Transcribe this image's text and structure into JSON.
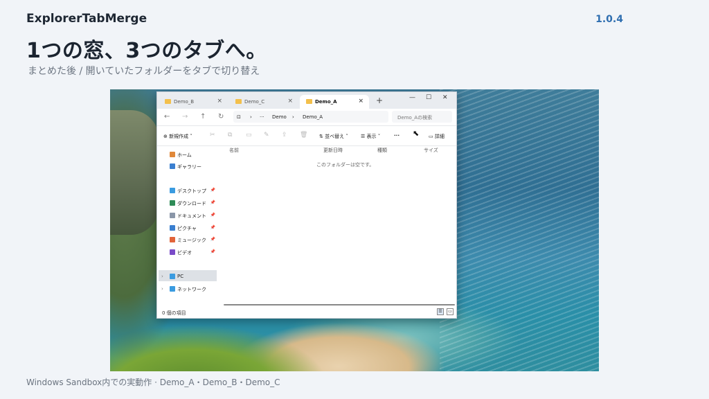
{
  "header": {
    "app_name": "ExplorerTabMerge",
    "version": "1.0.4",
    "headline": "1つの窓、3つのタブへ。",
    "subhead": "まとめた後 / 開いていたフォルダーをタブで切り替え"
  },
  "footer": {
    "caption": "Windows Sandbox内での実動作 · Demo_A・Demo_B・Demo_C"
  },
  "explorer": {
    "tabs": [
      {
        "label": "Demo_B",
        "close": "×"
      },
      {
        "label": "Demo_C",
        "close": "×"
      },
      {
        "label": "Demo_A",
        "close": "×"
      }
    ],
    "new_tab": "+",
    "window_controls": [
      "—",
      "☐",
      "✕"
    ],
    "nav": [
      "←",
      "→",
      "↑",
      "↻"
    ],
    "breadcrumb": [
      "⊡",
      "›",
      "···",
      "Demo",
      "›",
      "Demo_A"
    ],
    "search_placeholder": "Demo_Aの検索",
    "command_bar": {
      "new": "新規作成",
      "sort": "並べ替え",
      "view": "表示",
      "more": "···",
      "details": "詳細"
    },
    "sidebar": [
      {
        "label": "ホーム",
        "icon": "home-icon",
        "color": "#e0883a"
      },
      {
        "label": "ギャラリー",
        "icon": "gallery-icon",
        "color": "#3a7fd0"
      },
      {
        "label": "デスクトップ",
        "icon": "desktop-icon",
        "color": "#3a9be0",
        "pin": "📌"
      },
      {
        "label": "ダウンロード",
        "icon": "download-icon",
        "color": "#2e8b57",
        "pin": "📌"
      },
      {
        "label": "ドキュメント",
        "icon": "document-icon",
        "color": "#8a96a8",
        "pin": "📌"
      },
      {
        "label": "ピクチャ",
        "icon": "pictures-icon",
        "color": "#3a7fd0",
        "pin": "📌"
      },
      {
        "label": "ミュージック",
        "icon": "music-icon",
        "color": "#e2643a",
        "pin": "📌"
      },
      {
        "label": "ビデオ",
        "icon": "video-icon",
        "color": "#7a4bc8",
        "pin": "📌"
      },
      {
        "label": "PC",
        "icon": "pc-icon",
        "color": "#3a9be0"
      },
      {
        "label": "ネットワーク",
        "icon": "network-icon",
        "color": "#3a9be0"
      }
    ],
    "columns": [
      "名前",
      "更新日時",
      "種類",
      "サイズ"
    ],
    "empty_message": "このフォルダーは空です。",
    "status": "0 個の項目"
  }
}
